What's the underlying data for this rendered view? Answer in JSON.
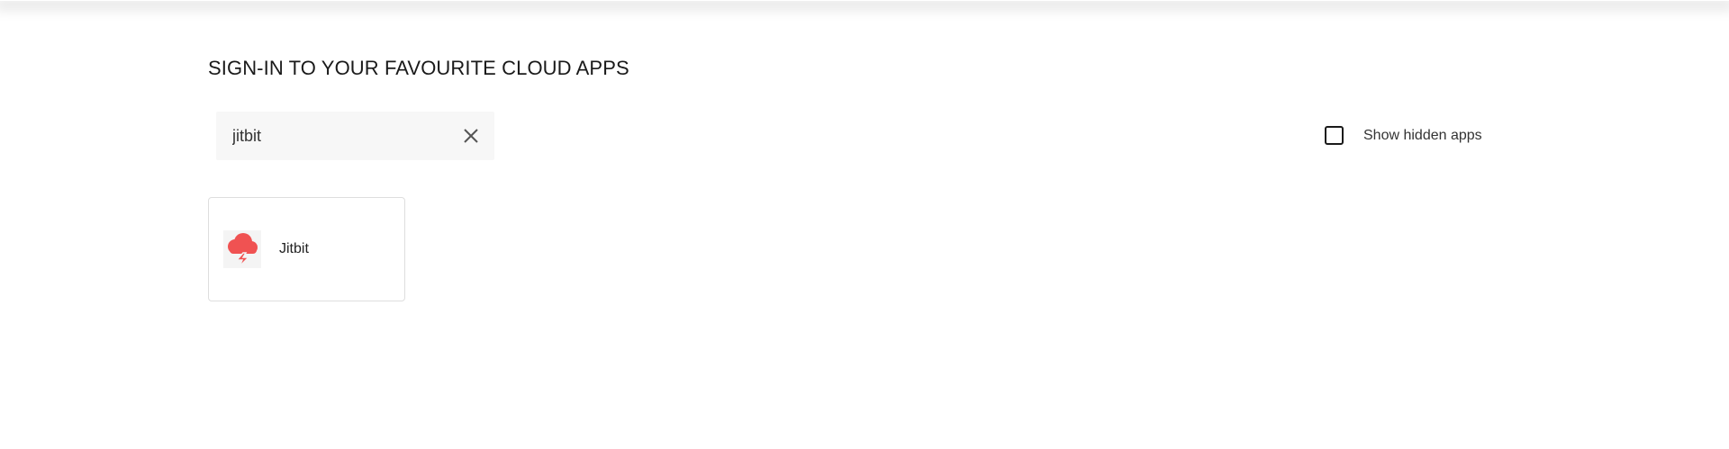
{
  "header": {
    "title": "SIGN-IN TO YOUR FAVOURITE CLOUD APPS"
  },
  "search": {
    "value": "jitbit",
    "clear_icon": "close-icon"
  },
  "filters": {
    "show_hidden_label": "Show hidden apps",
    "show_hidden_checked": false
  },
  "apps": [
    {
      "name": "Jitbit",
      "logo_icon": "cloud-lightning-icon",
      "logo_color": "#f05252"
    }
  ],
  "colors": {
    "accent": "#f05252",
    "search_bg": "#f7f7f7",
    "tile_border": "#dedede"
  }
}
